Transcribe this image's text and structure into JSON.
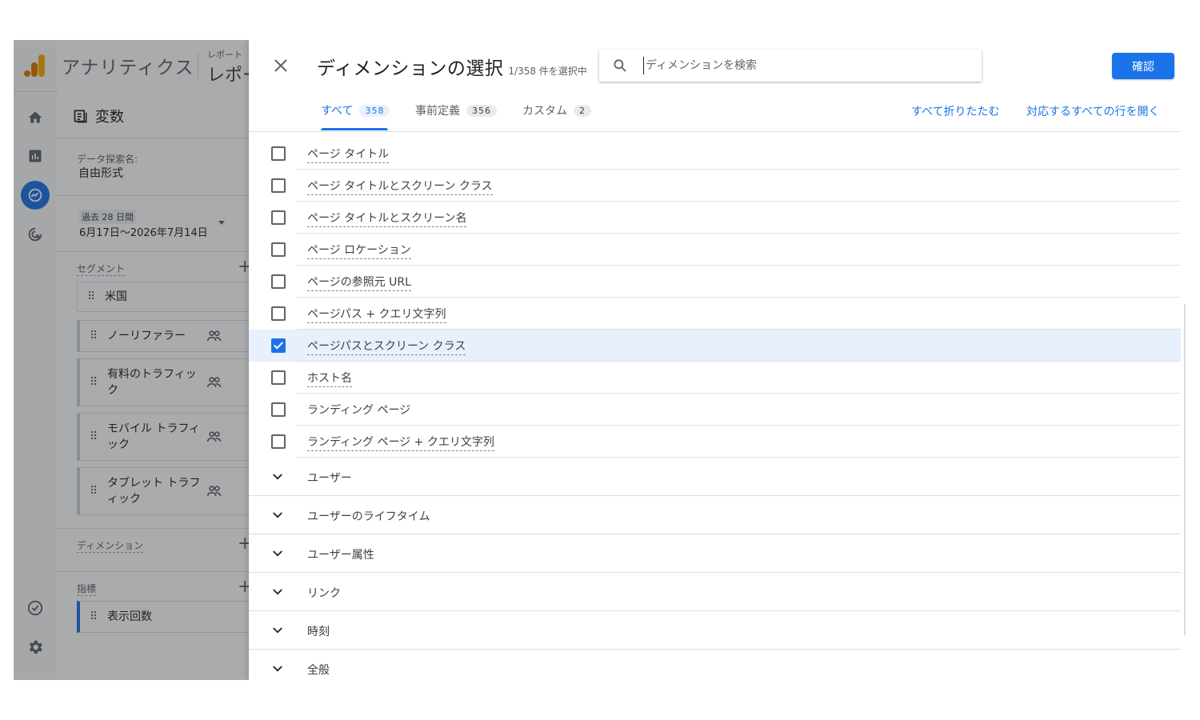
{
  "app": {
    "title": "アナリティクス",
    "breadcrumb_small": "レポート",
    "breadcrumb_big": "レポー"
  },
  "variables": {
    "title": "変数",
    "exploration_name_label": "データ探索名:",
    "exploration_name_value": "自由形式",
    "date_chip": "過去 28 日間",
    "date_range": "6月17日〜2026年7月14日",
    "segment_label": "セグメント",
    "segments": [
      {
        "label": "米国",
        "people": false
      },
      {
        "label": "ノーリファラー",
        "people": true
      },
      {
        "label": "有料のトラフィック",
        "people": true
      },
      {
        "label": "モバイル トラフィック",
        "people": true
      },
      {
        "label": "タブレット トラフィック",
        "people": true
      }
    ],
    "dimension_label": "ディメンション",
    "metric_label": "指標",
    "metrics": [
      {
        "label": "表示回数"
      }
    ]
  },
  "dialog": {
    "title": "ディメンションの選択",
    "count": "1/358 件を選択中",
    "search_placeholder": "ディメンションを検索",
    "confirm_label": "確認",
    "tabs": [
      {
        "label": "すべて",
        "count": "358"
      },
      {
        "label": "事前定義",
        "count": "356"
      },
      {
        "label": "カスタム",
        "count": "2"
      }
    ],
    "collapse_all": "すべて折りたたむ",
    "expand_all": "対応するすべての行を開く",
    "items": [
      {
        "label": "ページ タイトル",
        "checked": false
      },
      {
        "label": "ページ タイトルとスクリーン クラス",
        "checked": false
      },
      {
        "label": "ページ タイトルとスクリーン名",
        "checked": false
      },
      {
        "label": "ページ ロケーション",
        "checked": false
      },
      {
        "label": "ページの参照元 URL",
        "checked": false
      },
      {
        "label": "ページパス + クエリ文字列",
        "checked": false
      },
      {
        "label": "ページパスとスクリーン クラス",
        "checked": true
      },
      {
        "label": "ホスト名",
        "checked": false
      },
      {
        "label": "ランディング ページ",
        "checked": false
      },
      {
        "label": "ランディング ページ + クエリ文字列",
        "checked": false
      }
    ],
    "groups": [
      {
        "label": "ユーザー"
      },
      {
        "label": "ユーザーのライフタイム"
      },
      {
        "label": "ユーザー属性"
      },
      {
        "label": "リンク"
      },
      {
        "label": "時刻"
      },
      {
        "label": "全般"
      }
    ]
  },
  "colors": {
    "accent": "#1a73e8",
    "selected_row": "#e8f0fe",
    "logo_orange": "#f9ab00",
    "logo_dark": "#e37400"
  }
}
